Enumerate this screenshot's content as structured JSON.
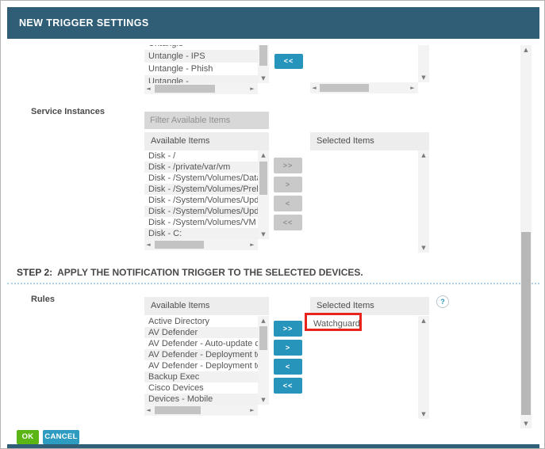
{
  "title": "NEW TRIGGER SETTINGS",
  "transfer": {
    "all_right": ">>",
    "one_right": ">",
    "one_left": "<",
    "all_left": "<<"
  },
  "top_partial_section": {
    "partial_item_above": "Untangle -",
    "items": [
      "Untangle - IPS",
      "Untangle - Phish"
    ],
    "partial_item_below": "Untangle -"
  },
  "service_instances": {
    "label": "Service Instances",
    "filter_placeholder": "Filter Available Items",
    "available_header": "Available Items",
    "selected_header": "Selected Items",
    "available_items": [
      "Disk - /",
      "Disk - /private/var/vm",
      "Disk - /System/Volumes/Data",
      "Disk - /System/Volumes/Preboot",
      "Disk - /System/Volumes/Update",
      "Disk - /System/Volumes/Update/",
      "Disk - /System/Volumes/VM",
      "Disk - C:"
    ],
    "selected_items": []
  },
  "step2": {
    "label": "STEP 2:",
    "text": "APPLY THE NOTIFICATION TRIGGER TO THE SELECTED DEVICES."
  },
  "rules": {
    "label": "Rules",
    "available_header": "Available Items",
    "selected_header": "Selected Items",
    "available_items": [
      "Active Directory",
      "AV Defender",
      "AV Defender - Auto-update confi",
      "AV Defender - Deployment to Se",
      "AV Defender - Deployment to Wo",
      "Backup Exec",
      "Cisco Devices",
      "Devices - Mobile"
    ],
    "selected_items": [
      "Watchguard"
    ],
    "help_label": "?"
  },
  "footer": {
    "ok": "OK",
    "cancel": "CANCEL"
  },
  "colors": {
    "header_bg": "#305e77",
    "accent_teal": "#2795bb",
    "ok_green": "#5bb514",
    "highlight_red": "#e9241c"
  }
}
